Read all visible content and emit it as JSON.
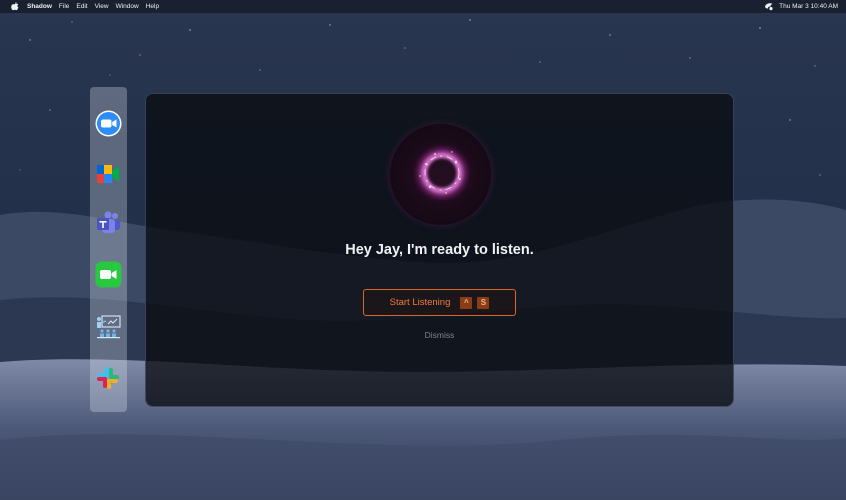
{
  "menubar": {
    "app_name": "Shadow",
    "items": [
      "File",
      "Edit",
      "View",
      "Window",
      "Help"
    ],
    "clock": "Thu Mar 3  10:40 AM"
  },
  "dock": {
    "apps": [
      {
        "name": "Zoom",
        "icon": "zoom-icon"
      },
      {
        "name": "Google Meet",
        "icon": "google-meet-icon"
      },
      {
        "name": "Microsoft Teams",
        "icon": "teams-icon"
      },
      {
        "name": "FaceTime",
        "icon": "facetime-icon"
      },
      {
        "name": "Presentation",
        "icon": "presentation-icon"
      },
      {
        "name": "Slack",
        "icon": "slack-icon"
      }
    ]
  },
  "assistant": {
    "greeting": "Hey Jay, I'm ready to listen.",
    "start_button": {
      "label": "Start Listening",
      "keys": [
        "^",
        "S"
      ]
    },
    "dismiss_label": "Dismiss"
  },
  "colors": {
    "accent": "#ef7d3a",
    "accent_border": "#d9672a",
    "orb_glow": "#e04fd0",
    "panel_bg": "#0a0c10"
  }
}
